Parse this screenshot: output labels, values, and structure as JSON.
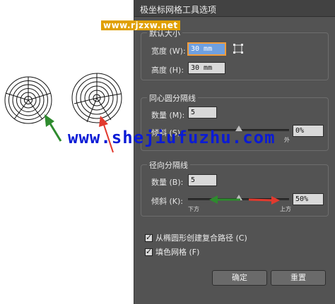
{
  "watermarks": {
    "top": "www.rjzxw.net",
    "big": "www.shejiufuzhu.com"
  },
  "dialog": {
    "title": "极坐标网格工具选项",
    "default_size": {
      "legend": "默认大小",
      "width_label": "宽度 (W):",
      "width_value": "30 mm",
      "height_label": "高度 (H):",
      "height_value": "30 mm"
    },
    "concentric": {
      "legend": "同心圆分隔线",
      "count_label": "数量 (M):",
      "count_value": "5",
      "skew_label": "倾斜 (S):",
      "skew_value": "0%",
      "skew_right_label": "外",
      "skew_fraction": 0.5
    },
    "radial": {
      "legend": "径向分隔线",
      "count_label": "数量 (B):",
      "count_value": "5",
      "skew_label": "倾斜 (K):",
      "skew_value": "50%",
      "skew_left_label": "下方",
      "skew_right_label": "上方",
      "skew_fraction": 0.5
    },
    "create_compound": {
      "label": "从椭圆形创建复合路径 (C)",
      "checked": true
    },
    "fill_grid": {
      "label": "填色网格 (F)",
      "checked": true
    },
    "buttons": {
      "ok": "确定",
      "reset": "重置"
    }
  },
  "colors": {
    "arrow_green": "#2e8b2e",
    "arrow_red": "#e23a2e",
    "focus": "#f19c3a"
  },
  "icons": [
    "link-width-height-icon",
    "green-arrow-icon",
    "red-arrow-icon"
  ]
}
